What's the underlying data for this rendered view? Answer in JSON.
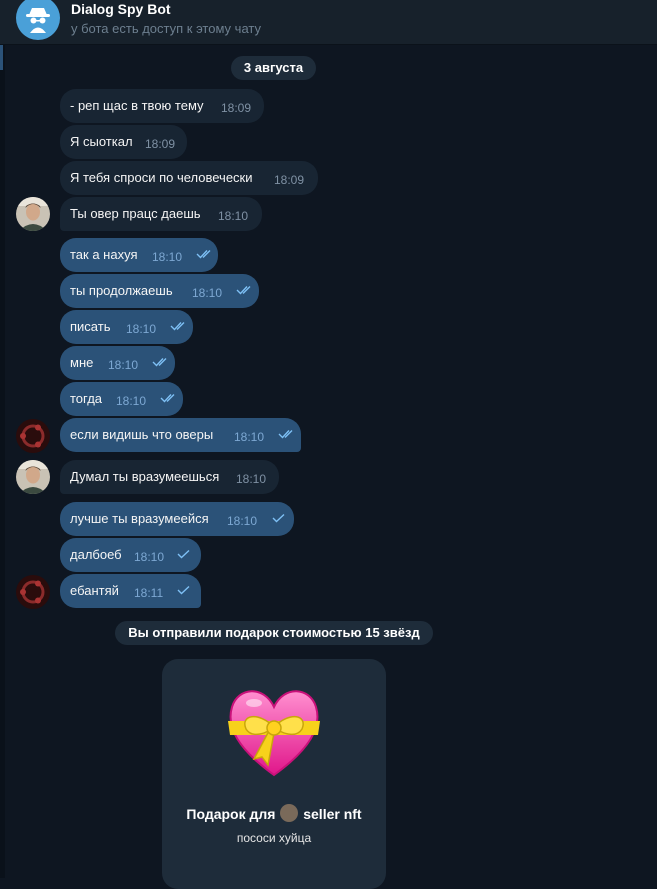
{
  "header": {
    "title": "Dialog Spy Bot",
    "subtitle": "у бота есть доступ к этому чату"
  },
  "date_label": "3 августа",
  "messages": [
    {
      "text": "- реп щас в твою тему",
      "time": "18:09",
      "dir": "in"
    },
    {
      "text": "Я сыоткал",
      "time": "18:09",
      "dir": "in"
    },
    {
      "text": "Я тебя спроси по человечески",
      "time": "18:09",
      "dir": "in"
    },
    {
      "text": "Ты овер працс даешь",
      "time": "18:10",
      "dir": "in"
    },
    {
      "text": "так а нахуя",
      "time": "18:10",
      "dir": "out",
      "status": "read"
    },
    {
      "text": "ты продолжаешь",
      "time": "18:10",
      "dir": "out",
      "status": "read"
    },
    {
      "text": "писать",
      "time": "18:10",
      "dir": "out",
      "status": "read"
    },
    {
      "text": "мне",
      "time": "18:10",
      "dir": "out",
      "status": "read"
    },
    {
      "text": "тогда",
      "time": "18:10",
      "dir": "out",
      "status": "read"
    },
    {
      "text": "если видишь что оверы",
      "time": "18:10",
      "dir": "out",
      "status": "read"
    },
    {
      "text": "Думал ты вразумеешься",
      "time": "18:10",
      "dir": "in"
    },
    {
      "text": "лучше ты вразумеейся",
      "time": "18:10",
      "dir": "out",
      "status": "sent"
    },
    {
      "text": "далбоеб",
      "time": "18:10",
      "dir": "out",
      "status": "sent"
    },
    {
      "text": "ебантяй",
      "time": "18:11",
      "dir": "out",
      "status": "sent"
    }
  ],
  "service_message": "Вы отправили подарок стоимостью 15 звёзд",
  "gift": {
    "title_prefix": "Подарок для",
    "recipient": "seller nft",
    "message": "пососи хуйца",
    "emoji": "heart-with-ribbon-icon"
  },
  "colors": {
    "background": "#0e1621",
    "incoming_bubble": "#182533",
    "outgoing_bubble": "#2b5278",
    "accent": "#4aa0d8"
  }
}
